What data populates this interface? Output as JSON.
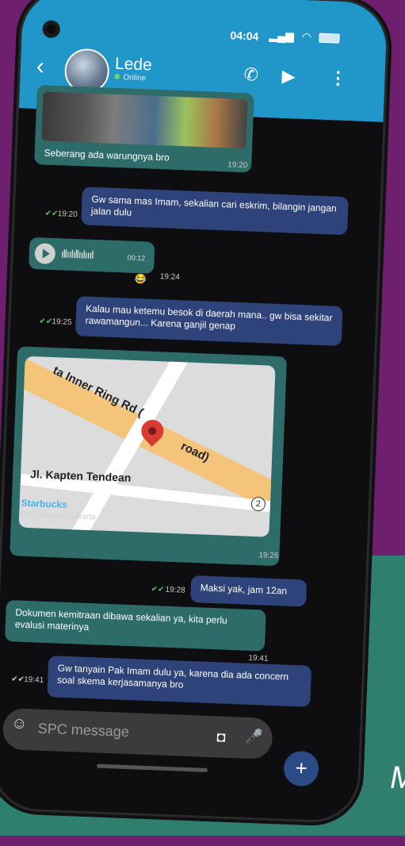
{
  "chat_header": {
    "back_icon": "arrow-left",
    "contact_name": "Lede",
    "status": "Online",
    "call_icon": "phone",
    "video_icon": "video-camera",
    "menu_icon": "kebab-menu"
  },
  "status_bar": {
    "time": "04:04",
    "icons": [
      "signal-bars",
      "wifi",
      "battery"
    ]
  },
  "messages": [
    {
      "type": "image",
      "direction": "in",
      "caption": "Seberang ada warungnya bro",
      "time": "19:20"
    },
    {
      "type": "text",
      "direction": "out",
      "text": "Gw sama mas Imam, sekalian  cari eskrim, bilangin jangan jalan dulu",
      "time": "19:20",
      "read": true
    },
    {
      "type": "audio",
      "direction": "in",
      "duration": "00:12",
      "time": "19:24",
      "reaction": "😂"
    },
    {
      "type": "text",
      "direction": "out",
      "text": "Kalau mau ketemu besok di daerah mana.. gw bisa sekitar rawamangun... Karena ganjil genap",
      "time": "19:25",
      "read": true
    },
    {
      "type": "location",
      "direction": "in",
      "map_labels": [
        "ta Inner Ring Rd (",
        "road)",
        "Jl. Kapten Tendean",
        "2"
      ],
      "place_name": "Starbucks",
      "place_address": "PIM, Jakarta, Jakarta",
      "time": "19:26"
    },
    {
      "type": "text",
      "direction": "out",
      "text": "Maksi yak, jam 12an",
      "time": "19:28",
      "read": true
    },
    {
      "type": "text",
      "direction": "in",
      "text": "Dokumen kemitraan dibawa sekalian ya, kita perlu evalusi materinya",
      "time": "19:41"
    },
    {
      "type": "text",
      "direction": "out",
      "text": "Gw tanyain Pak Imam dulu ya, karena dia ada concern soal skema kerjasamanya bro",
      "time": "19:41",
      "read": false
    }
  ],
  "composer": {
    "emoji_icon": "smiley",
    "placeholder": "SPC message",
    "camera_icon": "camera",
    "mic_icon": "microphone",
    "send_icon": "plus"
  },
  "colors": {
    "background_purple": "#6e1f6e",
    "background_teal": "#2f7f6f",
    "header_blue": "#2196c9",
    "incoming_bubble": "#2e6c6a",
    "outgoing_bubble": "#2d4379",
    "chat_bg": "#0e0e10",
    "fab": "#2c4a86"
  },
  "background_text": "M"
}
